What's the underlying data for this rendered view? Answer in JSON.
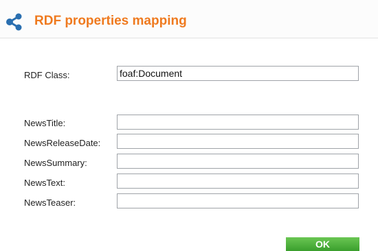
{
  "header": {
    "icon": "share-icon",
    "title": "RDF properties mapping",
    "accent_color": "#ef7a1f"
  },
  "form": {
    "rdf_class": {
      "label": "RDF Class:",
      "value": "foaf:Document"
    },
    "properties": [
      {
        "label": "NewsTitle:",
        "value": ""
      },
      {
        "label": "NewsReleaseDate:",
        "value": ""
      },
      {
        "label": "NewsSummary:",
        "value": ""
      },
      {
        "label": "NewsText:",
        "value": ""
      },
      {
        "label": "NewsTeaser:",
        "value": ""
      }
    ]
  },
  "actions": {
    "ok_label": "OK",
    "ok_color": "#4db33b"
  }
}
